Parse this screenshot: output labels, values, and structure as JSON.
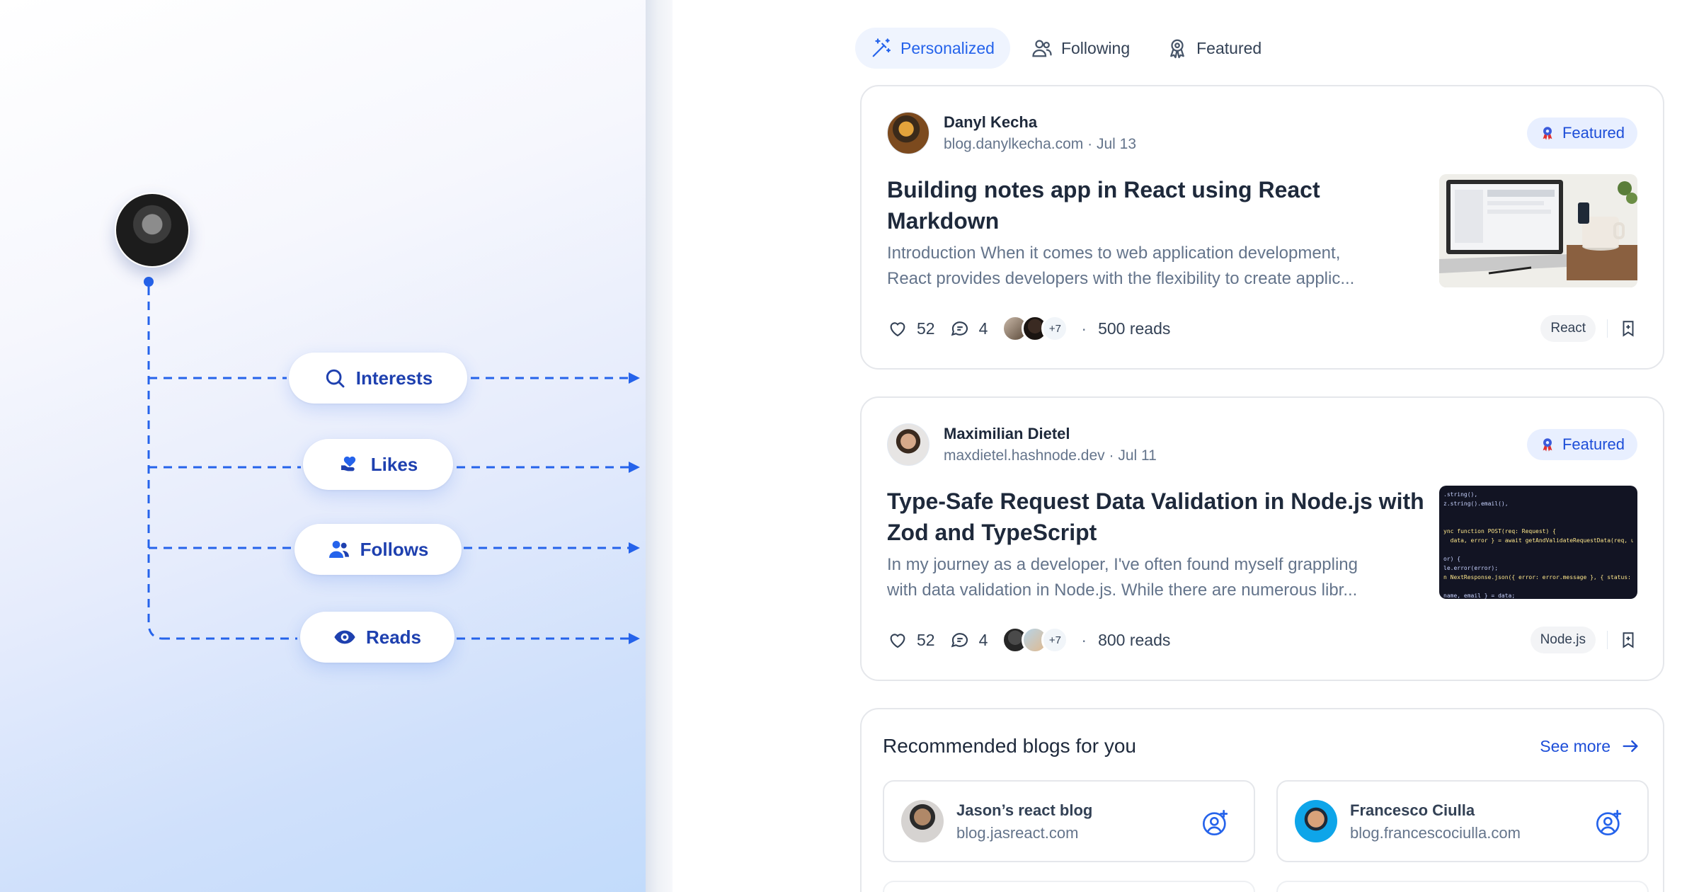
{
  "flow": {
    "pills": [
      {
        "label": "Interests",
        "icon": "search-icon"
      },
      {
        "label": "Likes",
        "icon": "hand-heart-icon"
      },
      {
        "label": "Follows",
        "icon": "users-icon"
      },
      {
        "label": "Reads",
        "icon": "eye-icon"
      }
    ]
  },
  "tabs": [
    {
      "label": "Personalized",
      "icon": "magic-wand-icon",
      "active": true
    },
    {
      "label": "Following",
      "icon": "users-icon",
      "active": false
    },
    {
      "label": "Featured",
      "icon": "award-icon",
      "active": false
    }
  ],
  "posts": [
    {
      "author": "Danyl Kecha",
      "domain": "blog.danylkecha.com",
      "date": "Jul 13",
      "badge": "Featured",
      "title": "Building notes app in React using React Markdown",
      "excerpt_line1": "Introduction When it comes to web application development,",
      "excerpt_line2": "React provides developers with the flexibility to create applic...",
      "likes": "52",
      "comments": "4",
      "more_readers": "+7",
      "reads": "500 reads",
      "tag": "React"
    },
    {
      "author": "Maximilian Dietel",
      "domain": "maxdietel.hashnode.dev",
      "date": "Jul 11",
      "badge": "Featured",
      "title": "Type-Safe Request Data Validation in Node.js with Zod and TypeScript",
      "excerpt_line1": "In my journey as a developer, I've often found myself grappling",
      "excerpt_line2": "with data validation in Node.js. While there are numerous libr...",
      "likes": "52",
      "comments": "4",
      "more_readers": "+7",
      "reads": "800 reads",
      "tag": "Node.js",
      "code_lines": [
        ".string(),",
        "z.string().email(),",
        "",
        "",
        "ync function POST(req: Request) {",
        "  data, error } = await getAndValidateRequestData(req, use",
        "",
        "or) {",
        "le.error(error);",
        "n NextResponse.json({ error: error.message }, { status: 4",
        "",
        "name, email } = data;"
      ]
    }
  ],
  "date_separator": "·",
  "stats_separator": "·",
  "recommended": {
    "title": "Recommended blogs for you",
    "see_more": "See more",
    "blogs": [
      {
        "name": "Jason’s react blog",
        "domain": "blog.jasreact.com"
      },
      {
        "name": "Francesco Ciulla",
        "domain": "blog.francescociulla.com"
      }
    ]
  },
  "colors": {
    "accent": "#2563eb",
    "accent_dark": "#1e40af",
    "badge_bg": "#e8efff",
    "muted_text": "#64748b"
  }
}
